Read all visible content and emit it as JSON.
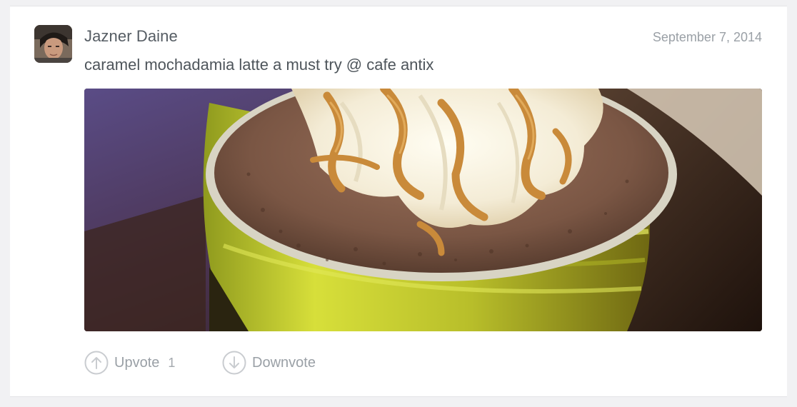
{
  "post": {
    "author": "Jazner Daine",
    "date": "September 7, 2014",
    "message": "caramel mochadamia latte a must try @ cafe antix",
    "avatar_icon": "user-avatar",
    "photo_icon": "photo"
  },
  "actions": {
    "upvote_label": "Upvote",
    "upvote_count": "1",
    "upvote_icon": "arrow-up-circle-icon",
    "downvote_label": "Downvote",
    "downvote_icon": "arrow-down-circle-icon"
  },
  "colors": {
    "card_bg": "#ffffff",
    "page_bg": "#f1f1f3",
    "text_primary": "#555c63",
    "text_muted": "#9aa0a6",
    "icon_stroke": "#c9ccd0"
  }
}
